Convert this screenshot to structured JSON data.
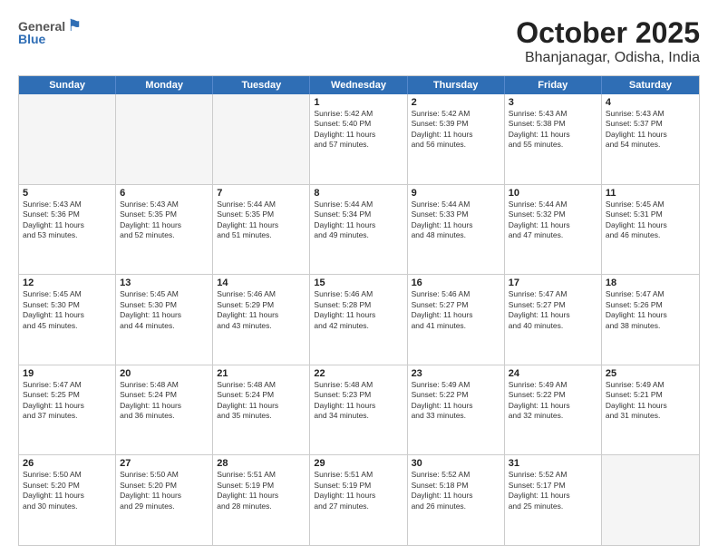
{
  "logo": {
    "general": "General",
    "blue": "Blue"
  },
  "title": "October 2025",
  "location": "Bhanjanagar, Odisha, India",
  "days": [
    "Sunday",
    "Monday",
    "Tuesday",
    "Wednesday",
    "Thursday",
    "Friday",
    "Saturday"
  ],
  "weeks": [
    [
      {
        "day": "",
        "info": ""
      },
      {
        "day": "",
        "info": ""
      },
      {
        "day": "",
        "info": ""
      },
      {
        "day": "1",
        "info": "Sunrise: 5:42 AM\nSunset: 5:40 PM\nDaylight: 11 hours\nand 57 minutes."
      },
      {
        "day": "2",
        "info": "Sunrise: 5:42 AM\nSunset: 5:39 PM\nDaylight: 11 hours\nand 56 minutes."
      },
      {
        "day": "3",
        "info": "Sunrise: 5:43 AM\nSunset: 5:38 PM\nDaylight: 11 hours\nand 55 minutes."
      },
      {
        "day": "4",
        "info": "Sunrise: 5:43 AM\nSunset: 5:37 PM\nDaylight: 11 hours\nand 54 minutes."
      }
    ],
    [
      {
        "day": "5",
        "info": "Sunrise: 5:43 AM\nSunset: 5:36 PM\nDaylight: 11 hours\nand 53 minutes."
      },
      {
        "day": "6",
        "info": "Sunrise: 5:43 AM\nSunset: 5:35 PM\nDaylight: 11 hours\nand 52 minutes."
      },
      {
        "day": "7",
        "info": "Sunrise: 5:44 AM\nSunset: 5:35 PM\nDaylight: 11 hours\nand 51 minutes."
      },
      {
        "day": "8",
        "info": "Sunrise: 5:44 AM\nSunset: 5:34 PM\nDaylight: 11 hours\nand 49 minutes."
      },
      {
        "day": "9",
        "info": "Sunrise: 5:44 AM\nSunset: 5:33 PM\nDaylight: 11 hours\nand 48 minutes."
      },
      {
        "day": "10",
        "info": "Sunrise: 5:44 AM\nSunset: 5:32 PM\nDaylight: 11 hours\nand 47 minutes."
      },
      {
        "day": "11",
        "info": "Sunrise: 5:45 AM\nSunset: 5:31 PM\nDaylight: 11 hours\nand 46 minutes."
      }
    ],
    [
      {
        "day": "12",
        "info": "Sunrise: 5:45 AM\nSunset: 5:30 PM\nDaylight: 11 hours\nand 45 minutes."
      },
      {
        "day": "13",
        "info": "Sunrise: 5:45 AM\nSunset: 5:30 PM\nDaylight: 11 hours\nand 44 minutes."
      },
      {
        "day": "14",
        "info": "Sunrise: 5:46 AM\nSunset: 5:29 PM\nDaylight: 11 hours\nand 43 minutes."
      },
      {
        "day": "15",
        "info": "Sunrise: 5:46 AM\nSunset: 5:28 PM\nDaylight: 11 hours\nand 42 minutes."
      },
      {
        "day": "16",
        "info": "Sunrise: 5:46 AM\nSunset: 5:27 PM\nDaylight: 11 hours\nand 41 minutes."
      },
      {
        "day": "17",
        "info": "Sunrise: 5:47 AM\nSunset: 5:27 PM\nDaylight: 11 hours\nand 40 minutes."
      },
      {
        "day": "18",
        "info": "Sunrise: 5:47 AM\nSunset: 5:26 PM\nDaylight: 11 hours\nand 38 minutes."
      }
    ],
    [
      {
        "day": "19",
        "info": "Sunrise: 5:47 AM\nSunset: 5:25 PM\nDaylight: 11 hours\nand 37 minutes."
      },
      {
        "day": "20",
        "info": "Sunrise: 5:48 AM\nSunset: 5:24 PM\nDaylight: 11 hours\nand 36 minutes."
      },
      {
        "day": "21",
        "info": "Sunrise: 5:48 AM\nSunset: 5:24 PM\nDaylight: 11 hours\nand 35 minutes."
      },
      {
        "day": "22",
        "info": "Sunrise: 5:48 AM\nSunset: 5:23 PM\nDaylight: 11 hours\nand 34 minutes."
      },
      {
        "day": "23",
        "info": "Sunrise: 5:49 AM\nSunset: 5:22 PM\nDaylight: 11 hours\nand 33 minutes."
      },
      {
        "day": "24",
        "info": "Sunrise: 5:49 AM\nSunset: 5:22 PM\nDaylight: 11 hours\nand 32 minutes."
      },
      {
        "day": "25",
        "info": "Sunrise: 5:49 AM\nSunset: 5:21 PM\nDaylight: 11 hours\nand 31 minutes."
      }
    ],
    [
      {
        "day": "26",
        "info": "Sunrise: 5:50 AM\nSunset: 5:20 PM\nDaylight: 11 hours\nand 30 minutes."
      },
      {
        "day": "27",
        "info": "Sunrise: 5:50 AM\nSunset: 5:20 PM\nDaylight: 11 hours\nand 29 minutes."
      },
      {
        "day": "28",
        "info": "Sunrise: 5:51 AM\nSunset: 5:19 PM\nDaylight: 11 hours\nand 28 minutes."
      },
      {
        "day": "29",
        "info": "Sunrise: 5:51 AM\nSunset: 5:19 PM\nDaylight: 11 hours\nand 27 minutes."
      },
      {
        "day": "30",
        "info": "Sunrise: 5:52 AM\nSunset: 5:18 PM\nDaylight: 11 hours\nand 26 minutes."
      },
      {
        "day": "31",
        "info": "Sunrise: 5:52 AM\nSunset: 5:17 PM\nDaylight: 11 hours\nand 25 minutes."
      },
      {
        "day": "",
        "info": ""
      }
    ]
  ]
}
